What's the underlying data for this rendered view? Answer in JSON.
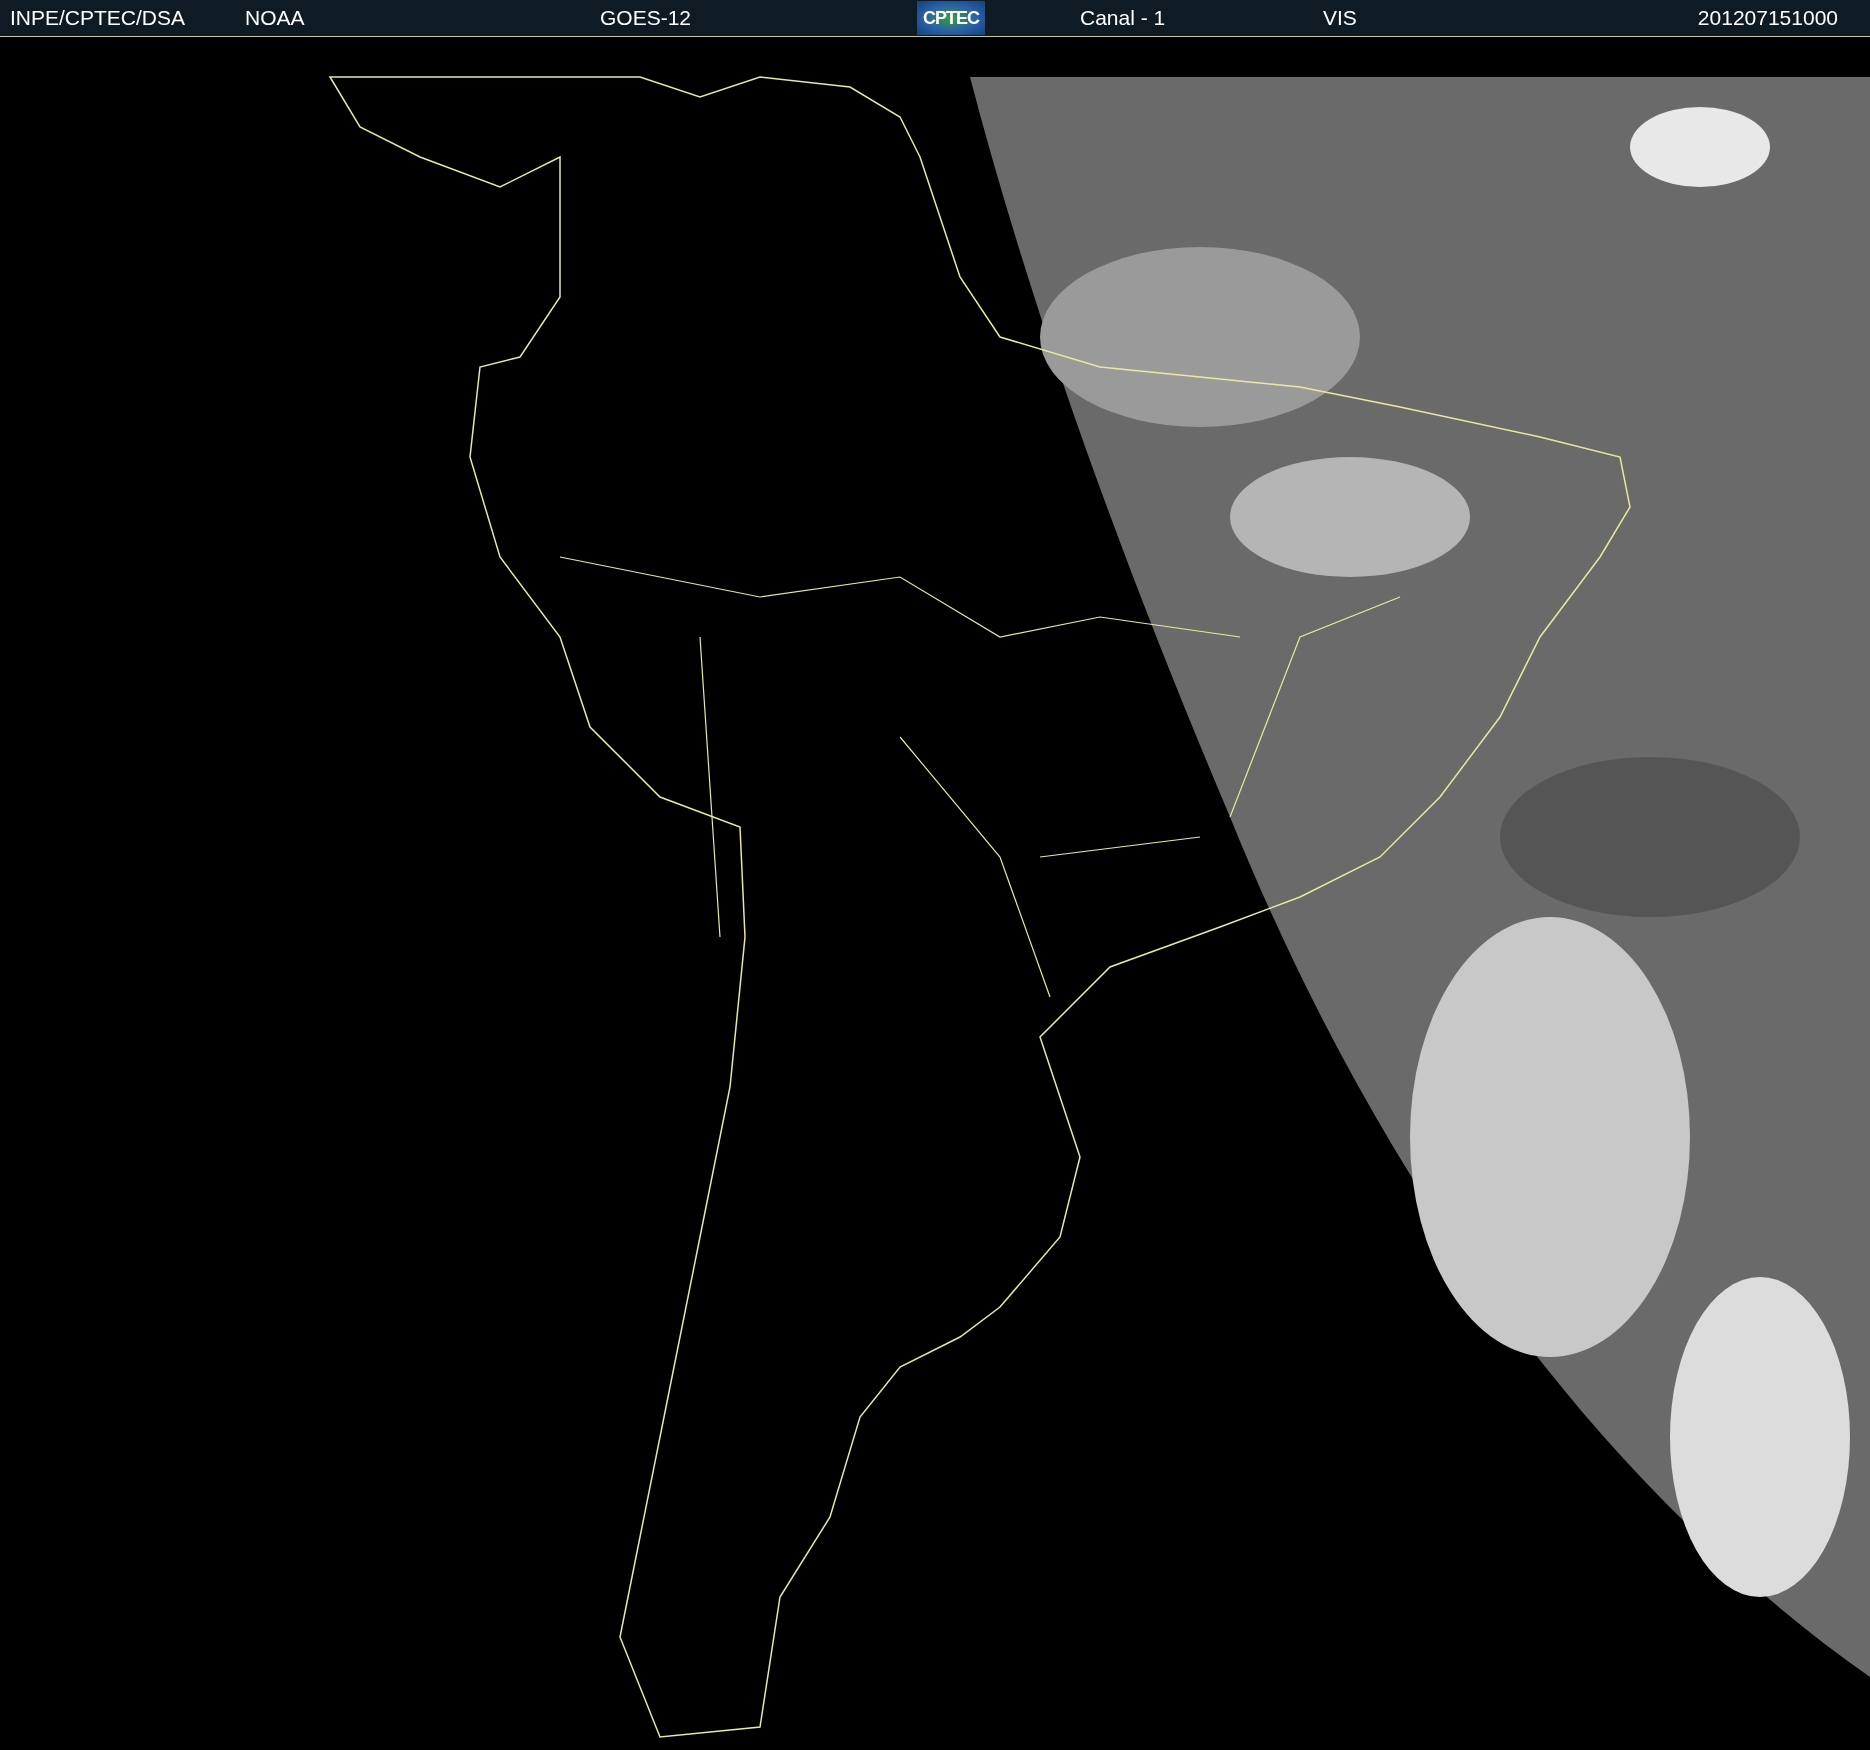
{
  "header": {
    "items": [
      {
        "kind": "text",
        "text": "INPE/CPTEC/DSA"
      },
      {
        "kind": "text",
        "text": "NOAA"
      },
      {
        "kind": "text",
        "text": "GOES-12"
      },
      {
        "kind": "logo",
        "text": "CPTEC"
      },
      {
        "kind": "text",
        "text": "Canal - 1"
      },
      {
        "kind": "text",
        "text": "VIS"
      },
      {
        "kind": "text",
        "text": "201207151000"
      }
    ]
  }
}
